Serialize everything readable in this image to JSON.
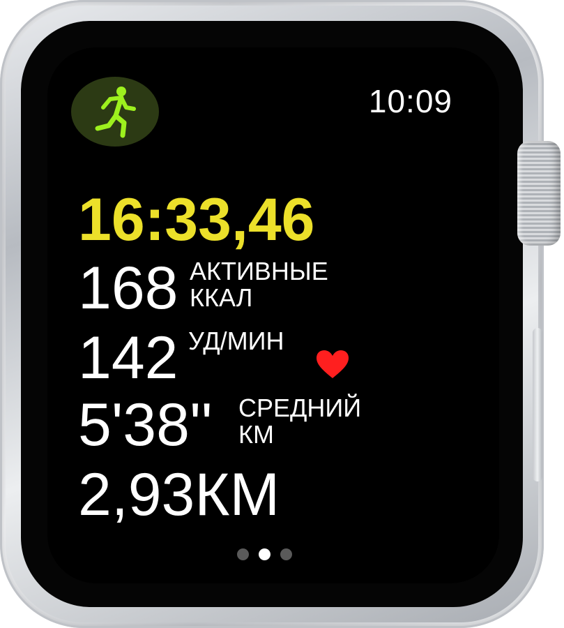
{
  "status_bar": {
    "time": "10:09"
  },
  "workout": {
    "app_icon": "running-figure-icon",
    "elapsed_time": "16:33,46",
    "active_calories": {
      "value": "168",
      "label_line1": "АКТИВНЫЕ",
      "label_line2": "ККАЛ"
    },
    "heart_rate": {
      "value": "142",
      "unit": "УД/МИН",
      "icon": "heart-icon"
    },
    "pace": {
      "value": "5'38''",
      "label_line1": "СРЕДНИЙ",
      "label_line2": "КМ"
    },
    "distance": {
      "value": "2,93КМ"
    }
  },
  "pagination": {
    "pages": 3,
    "active_index": 1
  },
  "colors": {
    "elapsed": "#ece02a",
    "icon_green": "#9df01e",
    "heart": "#ff1f1f",
    "screen": "#000000"
  }
}
